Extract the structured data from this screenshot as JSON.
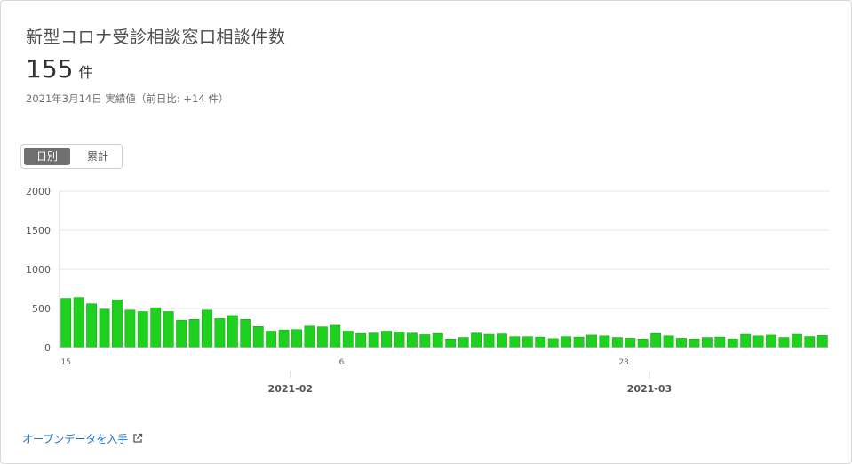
{
  "header": {
    "title": "新型コロナ受診相談窓口相談件数",
    "value": "155",
    "unit": "件",
    "subtitle": "2021年3月14日 実績値（前日比: +14 件）"
  },
  "toggle": {
    "daily_label": "日別",
    "cumulative_label": "累計",
    "selected": "daily"
  },
  "link": {
    "open_data_label": "オープンデータを入手",
    "icon": "external-link-icon"
  },
  "colors": {
    "bar": "#1fd11f",
    "bar_stroke": "#1aa81a",
    "grid": "#e6e6e6",
    "link": "#1a73c7"
  },
  "chart_data": {
    "type": "bar",
    "title": "",
    "xlabel": "",
    "ylabel": "",
    "ylim": [
      0,
      2000
    ],
    "yticks": [
      0,
      500,
      1000,
      1500,
      2000
    ],
    "x_start_label": "2021-01-15",
    "x_tick_labels": [
      {
        "index": 0,
        "label": "15"
      },
      {
        "index": 22,
        "label": "6"
      },
      {
        "index": 44,
        "label": "28"
      }
    ],
    "x_month_labels": [
      {
        "index": 18,
        "label": "2021-02"
      },
      {
        "index": 46,
        "label": "2021-03"
      }
    ],
    "values": [
      630,
      640,
      560,
      490,
      610,
      480,
      460,
      510,
      460,
      350,
      360,
      480,
      370,
      410,
      360,
      270,
      210,
      225,
      230,
      275,
      265,
      285,
      210,
      180,
      185,
      210,
      200,
      185,
      165,
      180,
      110,
      130,
      185,
      170,
      175,
      140,
      140,
      135,
      115,
      140,
      135,
      160,
      150,
      130,
      120,
      110,
      180,
      150,
      120,
      110,
      130,
      135,
      110,
      170,
      150,
      160,
      130,
      170,
      141,
      155
    ]
  }
}
